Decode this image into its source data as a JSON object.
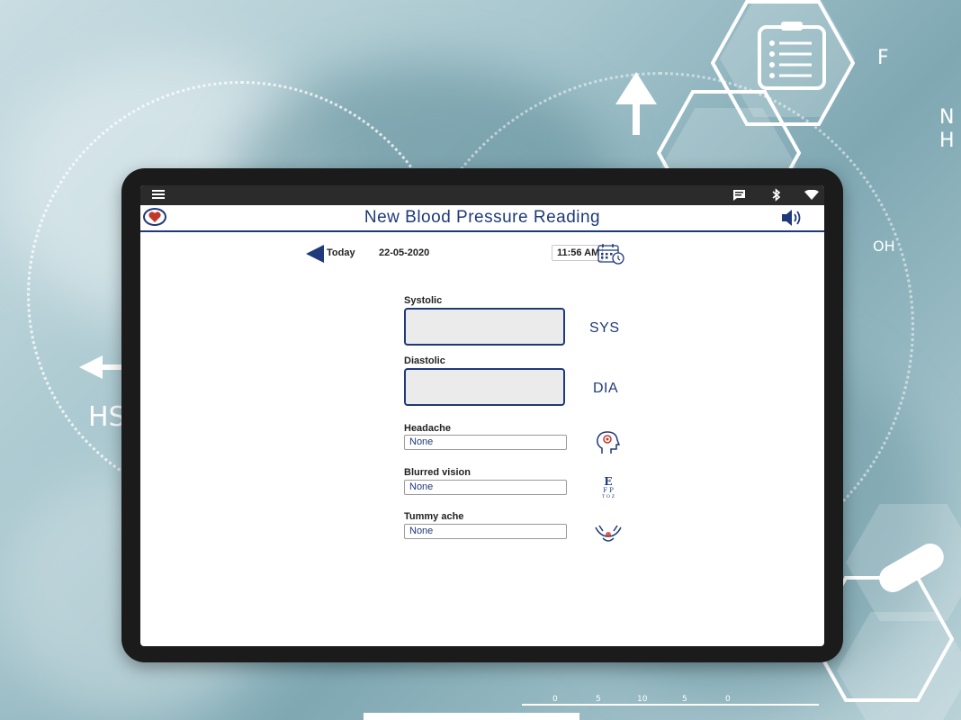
{
  "background": {
    "text_left": "HS",
    "chem_f": "F",
    "chem_n": "N",
    "chem_h": "H",
    "chem_oh": "OH",
    "ruler_ticks": [
      "0",
      "5",
      "10",
      "5",
      "0"
    ]
  },
  "app": {
    "title": "New Blood Pressure Reading",
    "accent_color": "#1f3a7a",
    "icons": {
      "menu": "menu-icon",
      "message": "message-icon",
      "bluetooth": "bluetooth-icon",
      "wifi": "wifi-icon",
      "heart": "heart-icon",
      "speaker": "speaker-icon",
      "back": "back-arrow-icon",
      "calendar": "calendar-clock-icon"
    }
  },
  "date_row": {
    "today_label": "Today",
    "date": "22-05-2020",
    "time": "11:56 AM"
  },
  "form": {
    "systolic": {
      "label": "Systolic",
      "value": "",
      "unit": "SYS"
    },
    "diastolic": {
      "label": "Diastolic",
      "value": "",
      "unit": "DIA"
    },
    "headache": {
      "label": "Headache",
      "value": "None",
      "icon": "head-icon"
    },
    "blurred_vision": {
      "label": "Blurred vision",
      "value": "None",
      "icon": "eye-chart-icon"
    },
    "tummy_ache": {
      "label": "Tummy ache",
      "value": "None",
      "icon": "tummy-icon"
    }
  }
}
